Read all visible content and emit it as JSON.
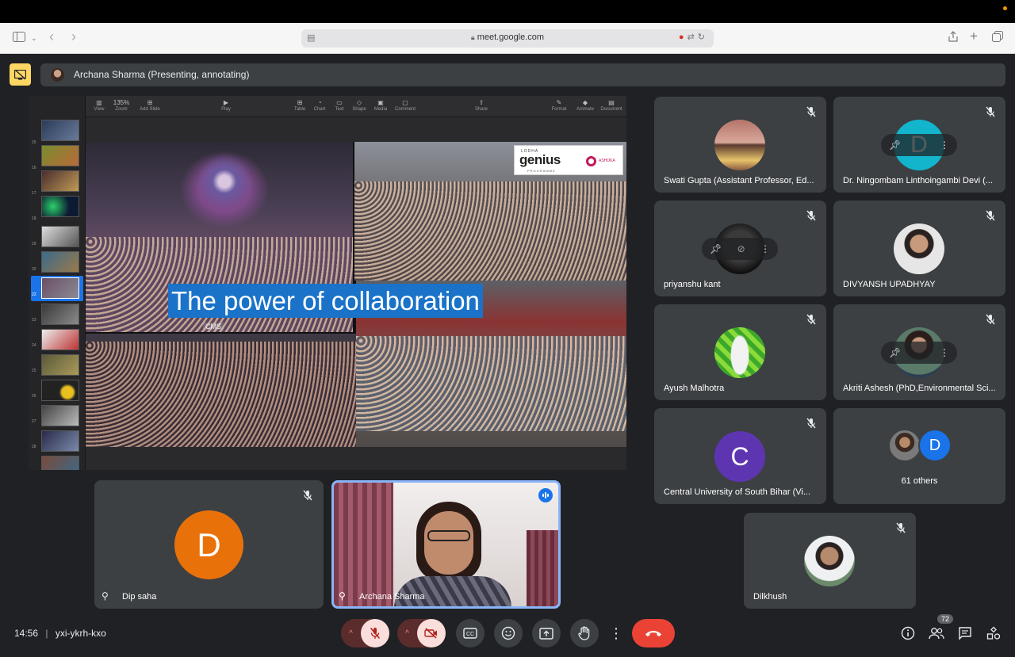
{
  "browser": {
    "url": "meet.google.com",
    "back_icon": "chevron-left-icon",
    "forward_icon": "chevron-right-icon"
  },
  "presenter_bar": {
    "label": "Archana Sharma (Presenting, annotating)"
  },
  "shared_screen": {
    "toolbar": [
      "View",
      "135%",
      "Add Slide",
      "Play",
      "Table",
      "Chart",
      "Text",
      "Shape",
      "Media",
      "Comment",
      "Share",
      "Format",
      "Animate",
      "Document"
    ],
    "zoom_sub": "Zoom",
    "thumbnails": [
      "15",
      "16",
      "17",
      "18",
      "19",
      "20",
      "21",
      "22",
      "23",
      "24",
      "25",
      "26",
      "27",
      "28"
    ],
    "selected_slide": "22",
    "slide_title": "The power of collaboration",
    "logo": {
      "lodha": "LODHA",
      "genius": "genius",
      "programme": "PROGRAMME",
      "ashoka": "ASHOKA"
    },
    "cms_label": "CMS"
  },
  "participants": [
    {
      "name": "Swati Gupta (Assistant Professor, Ed...",
      "muted": true
    },
    {
      "name": "Dr. Ningombam Linthoingambi Devi (...",
      "muted": true,
      "initial": "D"
    },
    {
      "name": "priyanshu kant",
      "muted": true
    },
    {
      "name": "DIVYANSH UPADHYAY",
      "muted": true
    },
    {
      "name": "Ayush Malhotra",
      "muted": true
    },
    {
      "name": "Akriti Ashesh (PhD,Environmental Sci...",
      "muted": true
    },
    {
      "name": "Central University of South Bihar (Vi...",
      "muted": true,
      "initial": "C"
    },
    {
      "name": "61 others",
      "initial": "D"
    },
    {
      "name": "Dilkhush",
      "muted": true
    }
  ],
  "bottom_tiles": [
    {
      "name": "Dip saha",
      "initial": "D",
      "muted": true
    },
    {
      "name": "Archana Sharma",
      "speaking": true
    }
  ],
  "meeting": {
    "time": "14:56",
    "separator": "|",
    "code": "yxi-ykrh-kxo"
  },
  "controls": {
    "people_count": "72"
  },
  "colors": {
    "background": "#202124",
    "tile": "#3c4043",
    "accent_blue": "#8ab4f8",
    "end_call": "#ea4335",
    "muted_btn": "#f9dedc",
    "presenting_icon": "#fdd663",
    "avatar_orange": "#e8710a",
    "avatar_purple": "#5e35b1",
    "avatar_blue": "#1a73e8"
  }
}
